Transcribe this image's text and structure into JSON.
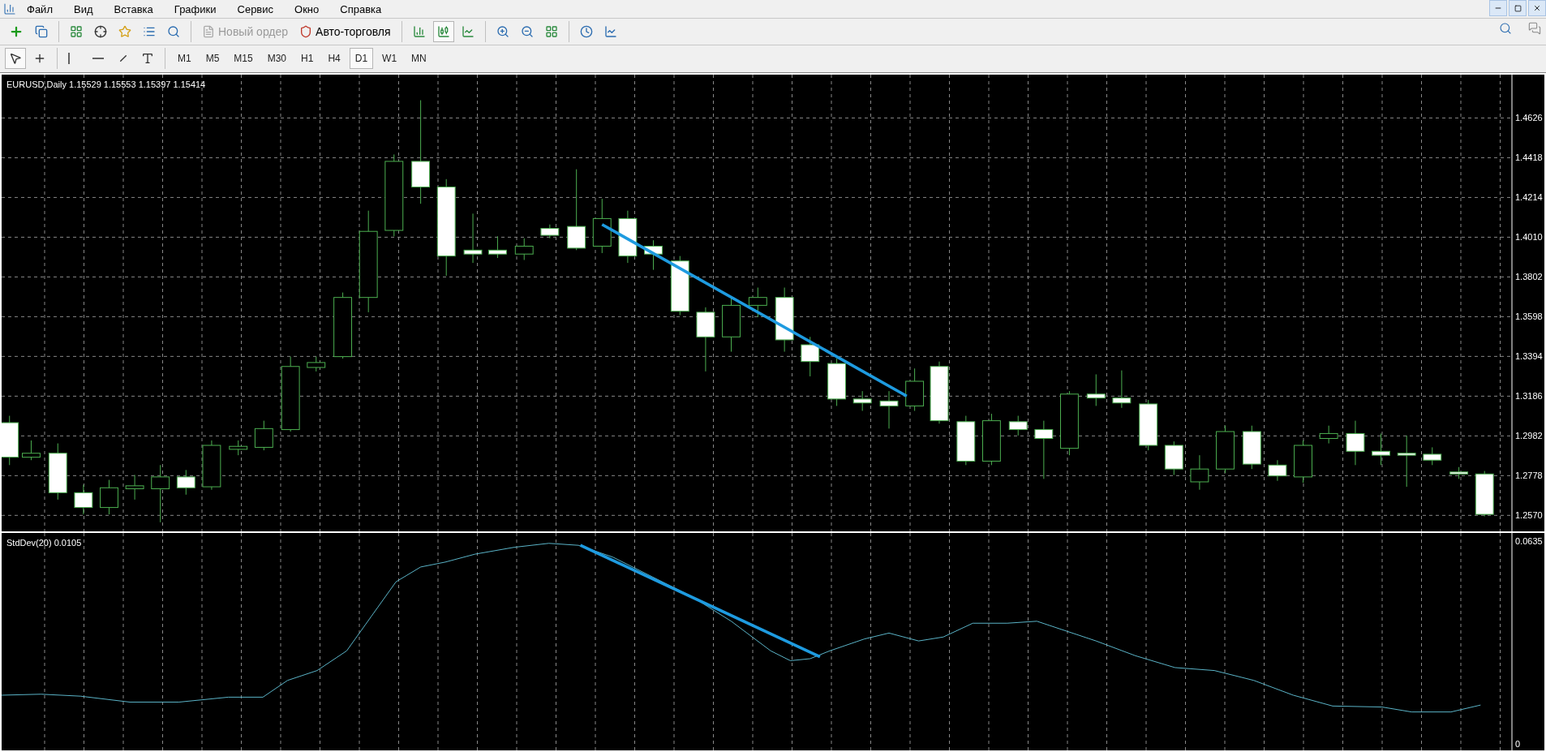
{
  "menu": [
    "Файл",
    "Вид",
    "Вставка",
    "Графики",
    "Сервис",
    "Окно",
    "Справка"
  ],
  "toolbar": [
    {
      "label": "Новый ордер",
      "disabled": true
    },
    {
      "label": "Авто-торговля",
      "disabled": false
    }
  ],
  "timeframes": [
    {
      "label": "M1",
      "selected": false
    },
    {
      "label": "M5",
      "selected": false
    },
    {
      "label": "M15",
      "selected": false
    },
    {
      "label": "M30",
      "selected": false
    },
    {
      "label": "H1",
      "selected": false
    },
    {
      "label": "H4",
      "selected": false
    },
    {
      "label": "D1",
      "selected": true
    },
    {
      "label": "W1",
      "selected": false
    },
    {
      "label": "MN",
      "selected": false
    }
  ],
  "chart": {
    "title": "EURUSD,Daily  1.15529 1.15553 1.15397 1.15414",
    "price_axis": [
      "1.4626",
      "1.4418",
      "1.4214",
      "1.4010",
      "1.3802",
      "1.3598",
      "1.3394",
      "1.3186",
      "1.2982",
      "1.2778",
      "1.2570"
    ]
  },
  "indicator": {
    "title": "StdDev(20) 0.0105",
    "axis": [
      "0.0635",
      "0"
    ]
  }
}
